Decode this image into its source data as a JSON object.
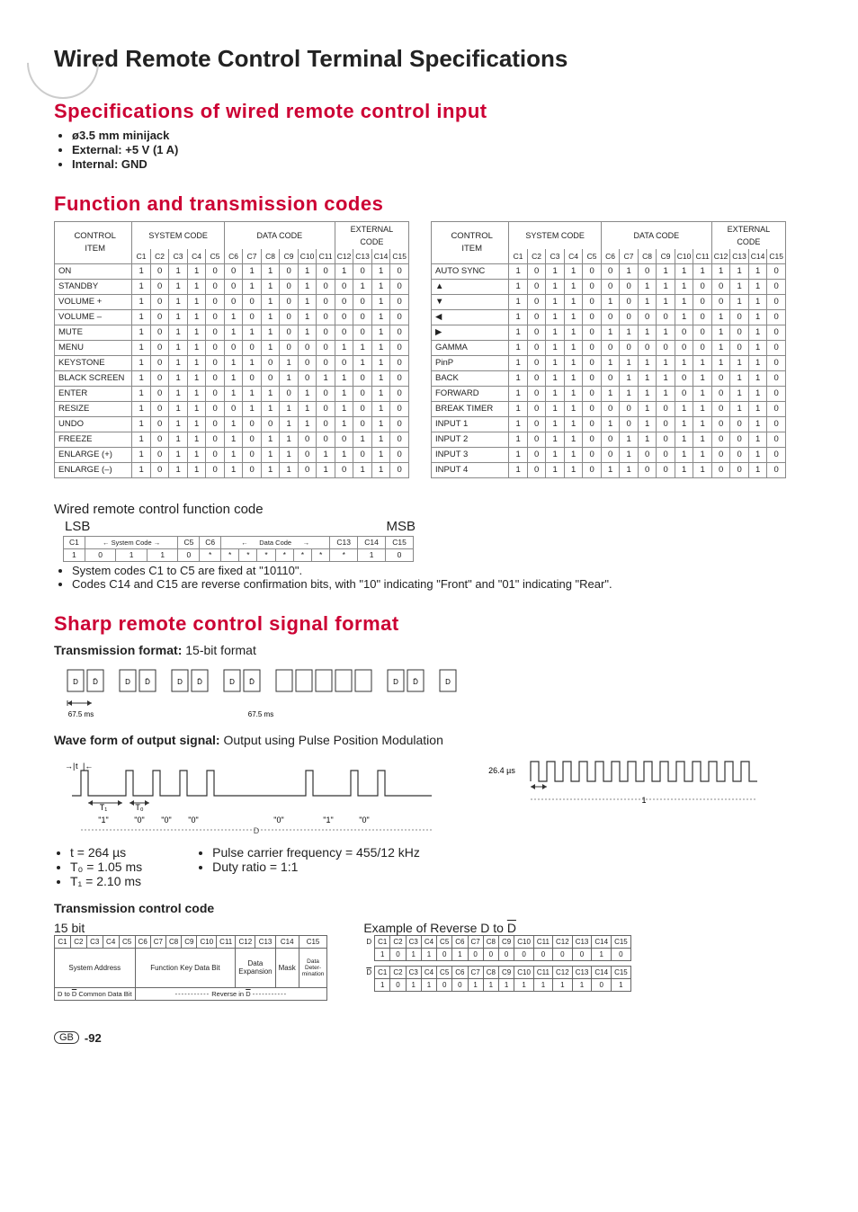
{
  "page_title": "Wired Remote Control Terminal Specifications",
  "section_specs": {
    "title": "Specifications of wired remote control input",
    "bullets": [
      "ø3.5 mm minijack",
      "External: +5 V (1 A)",
      "Internal: GND"
    ]
  },
  "section_codes_title": "Function and transmission codes",
  "col_headers": {
    "control_item": "CONTROL\nITEM",
    "system_code": "SYSTEM CODE",
    "data_code": "DATA CODE",
    "external_code": "EXTERNAL\nCODE",
    "bits": [
      "C1",
      "C2",
      "C3",
      "C4",
      "C5",
      "C6",
      "C7",
      "C8",
      "C9",
      "C10",
      "C11",
      "C12",
      "C13",
      "C14",
      "C15"
    ]
  },
  "table_left": [
    {
      "label": "ON",
      "bits": [
        "1",
        "0",
        "1",
        "1",
        "0",
        "0",
        "1",
        "1",
        "0",
        "1",
        "0",
        "1",
        "0",
        "1",
        "0"
      ]
    },
    {
      "label": "STANDBY",
      "bits": [
        "1",
        "0",
        "1",
        "1",
        "0",
        "0",
        "1",
        "1",
        "0",
        "1",
        "0",
        "0",
        "1",
        "1",
        "0"
      ]
    },
    {
      "label": "VOLUME +",
      "bits": [
        "1",
        "0",
        "1",
        "1",
        "0",
        "0",
        "0",
        "1",
        "0",
        "1",
        "0",
        "0",
        "0",
        "1",
        "0"
      ]
    },
    {
      "label": "VOLUME –",
      "bits": [
        "1",
        "0",
        "1",
        "1",
        "0",
        "1",
        "0",
        "1",
        "0",
        "1",
        "0",
        "0",
        "0",
        "1",
        "0"
      ]
    },
    {
      "label": "MUTE",
      "bits": [
        "1",
        "0",
        "1",
        "1",
        "0",
        "1",
        "1",
        "1",
        "0",
        "1",
        "0",
        "0",
        "0",
        "1",
        "0"
      ]
    },
    {
      "label": "MENU",
      "bits": [
        "1",
        "0",
        "1",
        "1",
        "0",
        "0",
        "0",
        "1",
        "0",
        "0",
        "0",
        "1",
        "1",
        "1",
        "0"
      ]
    },
    {
      "label": "KEYSTONE",
      "bits": [
        "1",
        "0",
        "1",
        "1",
        "0",
        "1",
        "1",
        "0",
        "1",
        "0",
        "0",
        "0",
        "1",
        "1",
        "0"
      ]
    },
    {
      "label": "BLACK SCREEN",
      "bits": [
        "1",
        "0",
        "1",
        "1",
        "0",
        "1",
        "0",
        "0",
        "1",
        "0",
        "1",
        "1",
        "0",
        "1",
        "0"
      ]
    },
    {
      "label": "ENTER",
      "bits": [
        "1",
        "0",
        "1",
        "1",
        "0",
        "1",
        "1",
        "1",
        "0",
        "1",
        "0",
        "1",
        "0",
        "1",
        "0"
      ]
    },
    {
      "label": "RESIZE",
      "bits": [
        "1",
        "0",
        "1",
        "1",
        "0",
        "0",
        "1",
        "1",
        "1",
        "1",
        "0",
        "1",
        "0",
        "1",
        "0"
      ]
    },
    {
      "label": "UNDO",
      "bits": [
        "1",
        "0",
        "1",
        "1",
        "0",
        "1",
        "0",
        "0",
        "1",
        "1",
        "0",
        "1",
        "0",
        "1",
        "0"
      ]
    },
    {
      "label": "FREEZE",
      "bits": [
        "1",
        "0",
        "1",
        "1",
        "0",
        "1",
        "0",
        "1",
        "1",
        "0",
        "0",
        "0",
        "1",
        "1",
        "0"
      ]
    },
    {
      "label": "ENLARGE (+)",
      "bits": [
        "1",
        "0",
        "1",
        "1",
        "0",
        "1",
        "0",
        "1",
        "1",
        "0",
        "1",
        "1",
        "0",
        "1",
        "0"
      ]
    },
    {
      "label": "ENLARGE (–)",
      "bits": [
        "1",
        "0",
        "1",
        "1",
        "0",
        "1",
        "0",
        "1",
        "1",
        "0",
        "1",
        "0",
        "1",
        "1",
        "0"
      ]
    }
  ],
  "table_right": [
    {
      "label": "AUTO SYNC",
      "bits": [
        "1",
        "0",
        "1",
        "1",
        "0",
        "0",
        "1",
        "0",
        "1",
        "1",
        "1",
        "1",
        "1",
        "1",
        "0"
      ]
    },
    {
      "label": "▲",
      "bits": [
        "1",
        "0",
        "1",
        "1",
        "0",
        "0",
        "0",
        "1",
        "1",
        "1",
        "0",
        "0",
        "1",
        "1",
        "0"
      ]
    },
    {
      "label": "▼",
      "bits": [
        "1",
        "0",
        "1",
        "1",
        "0",
        "1",
        "0",
        "1",
        "1",
        "1",
        "0",
        "0",
        "1",
        "1",
        "0"
      ]
    },
    {
      "label": "◀",
      "bits": [
        "1",
        "0",
        "1",
        "1",
        "0",
        "0",
        "0",
        "0",
        "0",
        "1",
        "0",
        "1",
        "0",
        "1",
        "0"
      ]
    },
    {
      "label": "▶",
      "bits": [
        "1",
        "0",
        "1",
        "1",
        "0",
        "1",
        "1",
        "1",
        "1",
        "0",
        "0",
        "1",
        "0",
        "1",
        "0"
      ]
    },
    {
      "label": "GAMMA",
      "bits": [
        "1",
        "0",
        "1",
        "1",
        "0",
        "0",
        "0",
        "0",
        "0",
        "0",
        "0",
        "1",
        "0",
        "1",
        "0"
      ]
    },
    {
      "label": "PinP",
      "bits": [
        "1",
        "0",
        "1",
        "1",
        "0",
        "1",
        "1",
        "1",
        "1",
        "1",
        "1",
        "1",
        "1",
        "1",
        "0"
      ]
    },
    {
      "label": "BACK",
      "bits": [
        "1",
        "0",
        "1",
        "1",
        "0",
        "0",
        "1",
        "1",
        "1",
        "0",
        "1",
        "0",
        "1",
        "1",
        "0"
      ]
    },
    {
      "label": "FORWARD",
      "bits": [
        "1",
        "0",
        "1",
        "1",
        "0",
        "1",
        "1",
        "1",
        "1",
        "0",
        "1",
        "0",
        "1",
        "1",
        "0"
      ]
    },
    {
      "label": "BREAK TIMER",
      "bits": [
        "1",
        "0",
        "1",
        "1",
        "0",
        "0",
        "0",
        "1",
        "0",
        "1",
        "1",
        "0",
        "1",
        "1",
        "0"
      ]
    },
    {
      "label": "INPUT 1",
      "bits": [
        "1",
        "0",
        "1",
        "1",
        "0",
        "1",
        "0",
        "1",
        "0",
        "1",
        "1",
        "0",
        "0",
        "1",
        "0"
      ]
    },
    {
      "label": "INPUT 2",
      "bits": [
        "1",
        "0",
        "1",
        "1",
        "0",
        "0",
        "1",
        "1",
        "0",
        "1",
        "1",
        "0",
        "0",
        "1",
        "0"
      ]
    },
    {
      "label": "INPUT 3",
      "bits": [
        "1",
        "0",
        "1",
        "1",
        "0",
        "0",
        "1",
        "0",
        "0",
        "1",
        "1",
        "0",
        "0",
        "1",
        "0"
      ]
    },
    {
      "label": "INPUT 4",
      "bits": [
        "1",
        "0",
        "1",
        "1",
        "0",
        "1",
        "1",
        "0",
        "0",
        "1",
        "1",
        "0",
        "0",
        "1",
        "0"
      ]
    }
  ],
  "func_code": {
    "heading": "Wired remote control function code",
    "lsb": "LSB",
    "msb": "MSB",
    "row1_left": "C1",
    "row1_sys_label": "System Code",
    "row1_c5": "C5",
    "row1_c6": "C6",
    "row1_data_label": "Data Code",
    "row1_c13": "C13",
    "row1_c14": "C14",
    "row1_c15": "C15",
    "row2": [
      "1",
      "0",
      "1",
      "1",
      "0",
      "*",
      "*",
      "*",
      "*",
      "*",
      "*",
      "*",
      "*",
      "1",
      "0"
    ],
    "notes": [
      "System codes C1 to C5 are fixed at \"10110\".",
      "Codes C14 and C15 are reverse confirmation bits, with \"10\" indicating \"Front\" and \"01\" indicating \"Rear\"."
    ]
  },
  "signal_format": {
    "title": "Sharp remote control signal  format",
    "trans_fmt_label": "Transmission format:",
    "trans_fmt_value": "15-bit format",
    "d_label": "D",
    "dbar_label": "D̄",
    "time_67_5": "67.5 ms",
    "wave_label_bold": "Wave form of output signal:",
    "wave_label_rest": "Output using Pulse Position Modulation",
    "wave_t": "t",
    "wave_T1": "T₁",
    "wave_T0": "T₀",
    "wave_vals": [
      "\"1\"",
      "\"0\"",
      "\"0\"",
      "\"0\"",
      "\"0\"",
      "\"1\"",
      "\"0\""
    ],
    "carrier_time": "26.4 µs",
    "carrier_one": "1",
    "params_left": [
      "t = 264 µs",
      "T₀ = 1.05 ms",
      "T₁ = 2.10 ms"
    ],
    "params_right": [
      "Pulse carrier frequency = 455/12 kHz",
      "Duty ratio = 1:1"
    ]
  },
  "tcc": {
    "head": "Transmission control code",
    "fifteen": "15 bit",
    "example_label": "Example of Reverse D to D̄",
    "cols": [
      "C1",
      "C2",
      "C3",
      "C4",
      "C5",
      "C6",
      "C7",
      "C8",
      "C9",
      "C10",
      "C11",
      "C12",
      "C13",
      "C14",
      "C15"
    ],
    "left_labels": {
      "sys": "System Address",
      "func": "Function Key Data Bit",
      "exp": "Data\nExpansion",
      "mask": "Mask",
      "det": "Data\nDeter-\nmination",
      "common": "D to D̄ Common Data Bit",
      "rev": "Reverse in D̄"
    },
    "d_label": "D",
    "dbar_label": "D̄",
    "exD": [
      "1",
      "0",
      "1",
      "1",
      "0",
      "1",
      "0",
      "0",
      "0",
      "0",
      "0",
      "0",
      "0",
      "1",
      "0"
    ],
    "exDbar": [
      "1",
      "0",
      "1",
      "1",
      "0",
      "0",
      "1",
      "1",
      "1",
      "1",
      "1",
      "1",
      "1",
      "0",
      "1"
    ]
  },
  "foot": {
    "gb": "GB",
    "page": "-92"
  }
}
